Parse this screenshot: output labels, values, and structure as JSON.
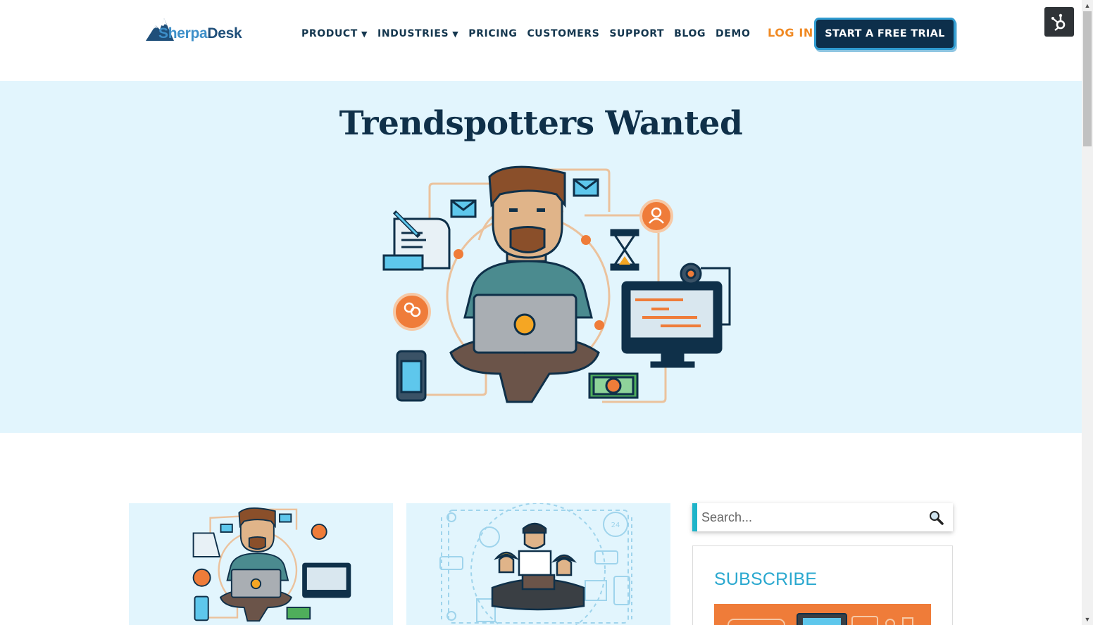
{
  "header": {
    "logo": {
      "part1": "Sherpa",
      "part2": "Desk",
      "icon": "mountain-logo-icon"
    },
    "nav": [
      {
        "label": "PRODUCT",
        "caret": "▼"
      },
      {
        "label": "INDUSTRIES",
        "caret": "▼"
      },
      {
        "label": "PRICING"
      },
      {
        "label": "CUSTOMERS"
      },
      {
        "label": "SUPPORT"
      },
      {
        "label": "BLOG"
      },
      {
        "label": "DEMO"
      }
    ],
    "login_label": "LOG IN",
    "cta_label": "START A FREE TRIAL",
    "hubspot_icon": "hubspot-sprocket-icon"
  },
  "hero": {
    "title": "Trendspotters Wanted",
    "illustration": "developer-with-laptop-illustration"
  },
  "cards": [
    {
      "illustration": "developer-with-laptop-illustration"
    },
    {
      "illustration": "team-meeting-illustration"
    }
  ],
  "sidebar": {
    "search": {
      "placeholder": "Search...",
      "value": "",
      "icon": "magnifier-icon"
    },
    "subscribe": {
      "title": "SUBSCRIBE"
    }
  },
  "colors": {
    "navy": "#0f3049",
    "orange": "#f08a24",
    "hero_bg": "#e2f5fd",
    "accent_cyan": "#1fb4c9",
    "subscribe_blue": "#2aa8cf"
  }
}
